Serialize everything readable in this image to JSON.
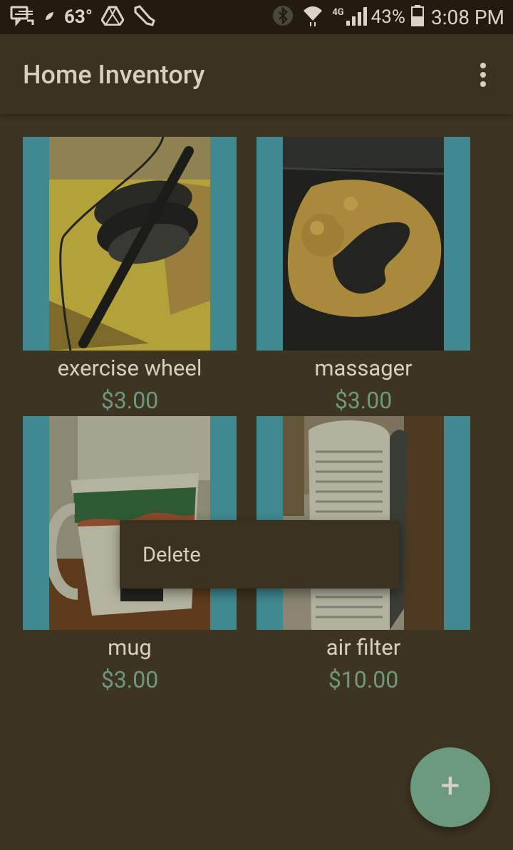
{
  "status_bar": {
    "temperature": "63°",
    "network": "4G",
    "battery": "43%",
    "time": "3:08 PM",
    "icons": {
      "left": [
        "message-icon",
        "leaf-icon",
        "drive-icon",
        "shoe-icon"
      ],
      "right": [
        "bluetooth-icon",
        "wifi-icon",
        "signal-icon",
        "battery-icon"
      ]
    }
  },
  "app_bar": {
    "title": "Home Inventory",
    "overflow_icon": "more-vert-icon"
  },
  "items": [
    {
      "name": "exercise wheel",
      "price": "$3.00"
    },
    {
      "name": "massager",
      "price": "$3.00"
    },
    {
      "name": "mug",
      "price": "$3.00"
    },
    {
      "name": "air filter",
      "price": "$10.00"
    }
  ],
  "context_menu": {
    "delete_label": "Delete"
  },
  "fab": {
    "icon": "add-icon",
    "label": "+"
  },
  "colors": {
    "background": "#3d3421",
    "status_bar": "#221c10",
    "thumbnail_bg": "#3f8a90",
    "price": "#6d9a7f",
    "fab": "#6b9a7f"
  }
}
